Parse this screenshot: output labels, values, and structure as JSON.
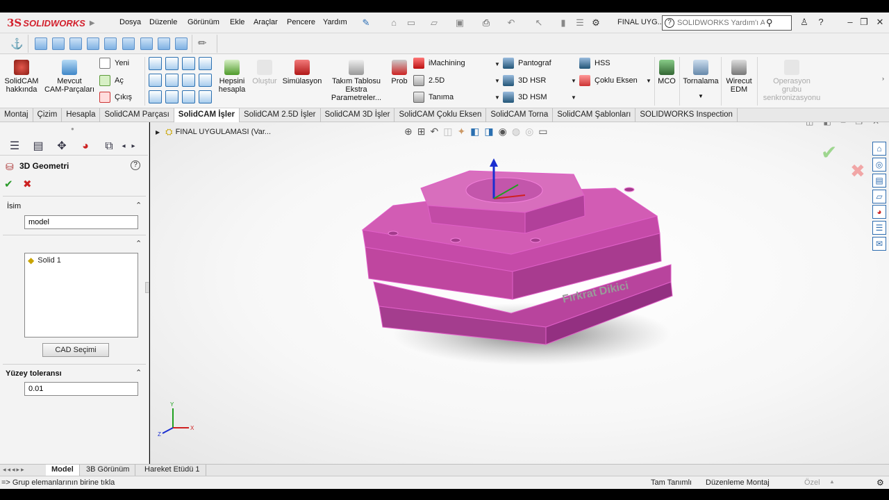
{
  "app": {
    "logo_ds": "3S",
    "logo_text": "SOLIDWORKS"
  },
  "menu": [
    "Dosya",
    "Düzenle",
    "Görünüm",
    "Ekle",
    "Araçlar",
    "Pencere",
    "Yardım"
  ],
  "document_title": "FINAL UYG...",
  "help_search": {
    "placeholder": "SOLIDWORKS Yardım'ı Ara"
  },
  "ribbon": {
    "solidcam_about": "SolidCAM\nhakkında",
    "existing_cam": "Mevcut\nCAM-Parçaları",
    "new": "Yeni",
    "open": "Aç",
    "exit": "Çıkış",
    "calc_all": "Hepsini\nhesapla",
    "create": "Oluştur",
    "simulation": "Simülasyon",
    "tool_table": "Takım Tablosu\nEkstra\nParametreler...",
    "probe": "Prob",
    "imachining": "iMachining",
    "two_five_d": "2.5D",
    "definition": "Tanıma",
    "pantograph": "Pantograf",
    "hsr": "3D HSR",
    "hsm": "3D HSM",
    "hss": "HSS",
    "multiaxis": "Çoklu Eksen",
    "mco": "MCO",
    "turning": "Tornalama",
    "wirecut": "Wirecut\nEDM",
    "op_group_sync": "Operasyon\ngrubu\nsenkronizasyonu"
  },
  "tabs": [
    "Montaj",
    "Çizim",
    "Hesapla",
    "SolidCAM Parçası",
    "SolidCAM İşler",
    "SolidCAM 2.5D İşler",
    "SolidCAM 3D İşler",
    "SolidCAM Çoklu Eksen",
    "SolidCAM Torna",
    "SolidCAM Şablonları",
    "SOLIDWORKS Inspection"
  ],
  "active_tab": "SolidCAM İşler",
  "panel": {
    "title": "3D Geometri",
    "name_section": "İsim",
    "name_value": "model",
    "solid_item": "Solid 1",
    "cad_button": "CAD Seçimi",
    "tolerance_section": "Yüzey toleransı",
    "tolerance_value": "0.01"
  },
  "viewport": {
    "tree_title": "FINAL UYGULAMASI  (Var...",
    "engraving": "Fırkrat Dikici",
    "triad_labels": {
      "x": "X",
      "y": "Y",
      "z": "Z"
    }
  },
  "bottom_tabs": [
    "Model",
    "3B Görünüm",
    "Hareket Etüdü 1"
  ],
  "status": {
    "message": "=> Grup elemanlarının birine tıkla",
    "underdefined": "Tam Tanımlı",
    "editing": "Düzenleme Montaj",
    "custom": "Özel"
  },
  "colors": {
    "accent": "#d3202c",
    "part": "#d04fb0",
    "part_edge": "#e060c8"
  }
}
